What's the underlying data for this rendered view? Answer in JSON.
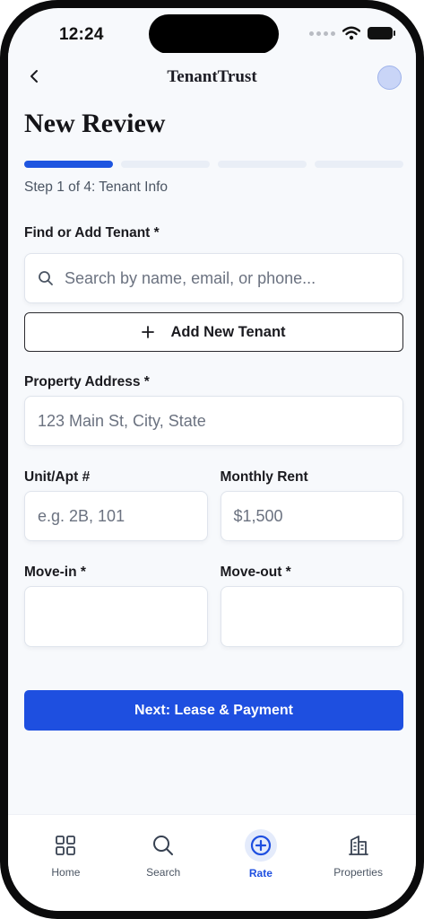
{
  "status": {
    "time": "12:24"
  },
  "nav": {
    "brand": "TenantTrust"
  },
  "page": {
    "title": "New Review",
    "progress": {
      "current_step": 1,
      "total_steps": 4
    },
    "step_text": "Step 1 of 4: Tenant Info"
  },
  "form": {
    "find_label": "Find or Add Tenant *",
    "search_placeholder": "Search by name, email, or phone...",
    "add_tenant_label": "Add New Tenant",
    "address_label": "Property Address *",
    "address_placeholder": "123 Main St, City, State",
    "unit_label": "Unit/Apt #",
    "unit_placeholder": "e.g. 2B, 101",
    "rent_label": "Monthly Rent",
    "rent_placeholder": "$1,500",
    "movein_label": "Move-in *",
    "moveout_label": "Move-out *",
    "next_label": "Next: Lease & Payment"
  },
  "tabs": [
    {
      "label": "Home",
      "icon": "grid-icon"
    },
    {
      "label": "Search",
      "icon": "search-icon"
    },
    {
      "label": "Rate",
      "icon": "plus-circle-icon",
      "active": true
    },
    {
      "label": "Properties",
      "icon": "building-icon"
    }
  ],
  "colors": {
    "accent": "#1e4fe0",
    "progress_inactive": "#e9eef6",
    "background": "#f7f9fc"
  }
}
